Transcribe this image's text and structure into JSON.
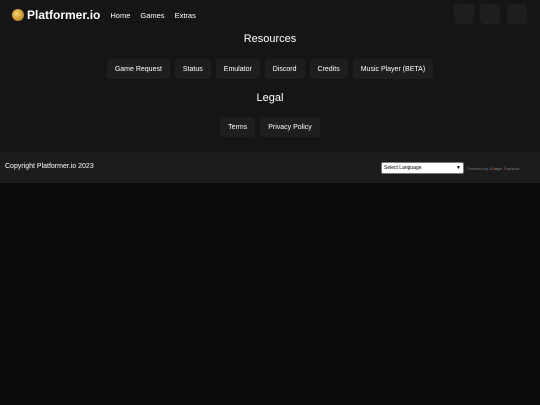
{
  "header": {
    "logo_text": "Platformer.io",
    "nav": [
      "Home",
      "Games",
      "Extras"
    ]
  },
  "resources": {
    "title": "Resources",
    "buttons": [
      "Game Request",
      "Status",
      "Emulator",
      "Discord",
      "Credits",
      "Music Player (BETA)"
    ]
  },
  "legal": {
    "title": "Legal",
    "buttons": [
      "Terms",
      "Privacy Policy"
    ]
  },
  "footer": {
    "copyright": "Copyright Platformer.io 2023",
    "language_select": "Select Language",
    "powered_by": "Powered by",
    "google": [
      "G",
      "o",
      "o",
      "g",
      "l",
      "e"
    ],
    "translate": "Translate"
  },
  "colors": {
    "page_bg": "#0b0b0b",
    "section_bg": "#151515",
    "button_bg": "#1e1e1e",
    "footer_bg": "#1c1c1c"
  },
  "icons": [
    "logo-icon",
    "top-right-icon-1",
    "top-right-icon-2",
    "top-right-icon-3"
  ]
}
